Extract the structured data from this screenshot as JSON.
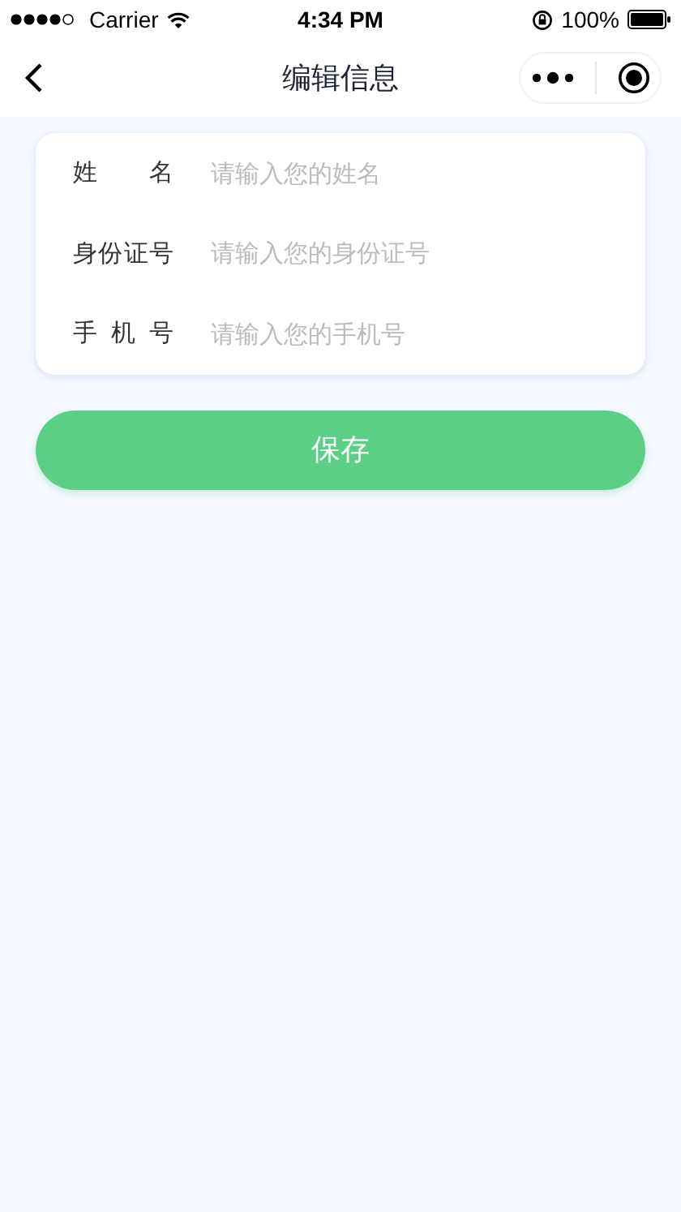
{
  "status_bar": {
    "carrier": "Carrier",
    "time": "4:34 PM",
    "battery": "100%"
  },
  "nav": {
    "title": "编辑信息"
  },
  "form": {
    "fields": [
      {
        "label": "姓名",
        "placeholder": "请输入您的姓名"
      },
      {
        "label": "身份证号",
        "placeholder": "请输入您的身份证号"
      },
      {
        "label": "手机号",
        "placeholder": "请输入您的手机号"
      }
    ]
  },
  "save_button": "保存"
}
